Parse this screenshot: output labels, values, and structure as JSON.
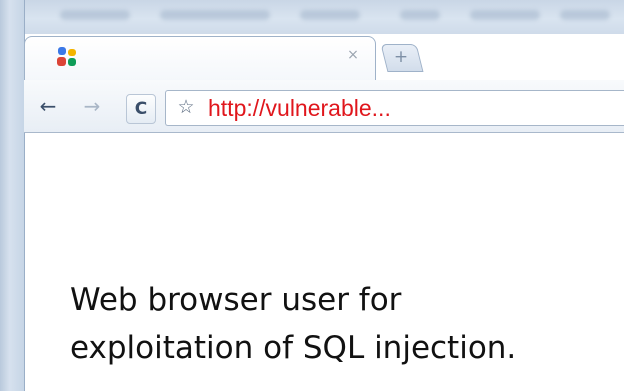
{
  "browser": {
    "tab": {
      "favicon": "google-favicon-icon",
      "close_glyph": "×"
    },
    "new_tab_glyph": "+",
    "toolbar": {
      "back_glyph": "←",
      "forward_glyph": "→",
      "reload_glyph": "C",
      "bookmark_glyph": "☆"
    },
    "address_bar": {
      "url": "http://vulnerable...",
      "url_color": "#e0161c"
    }
  },
  "caption": {
    "line1": "Web browser user for",
    "line2": "exploitation of SQL injection."
  }
}
